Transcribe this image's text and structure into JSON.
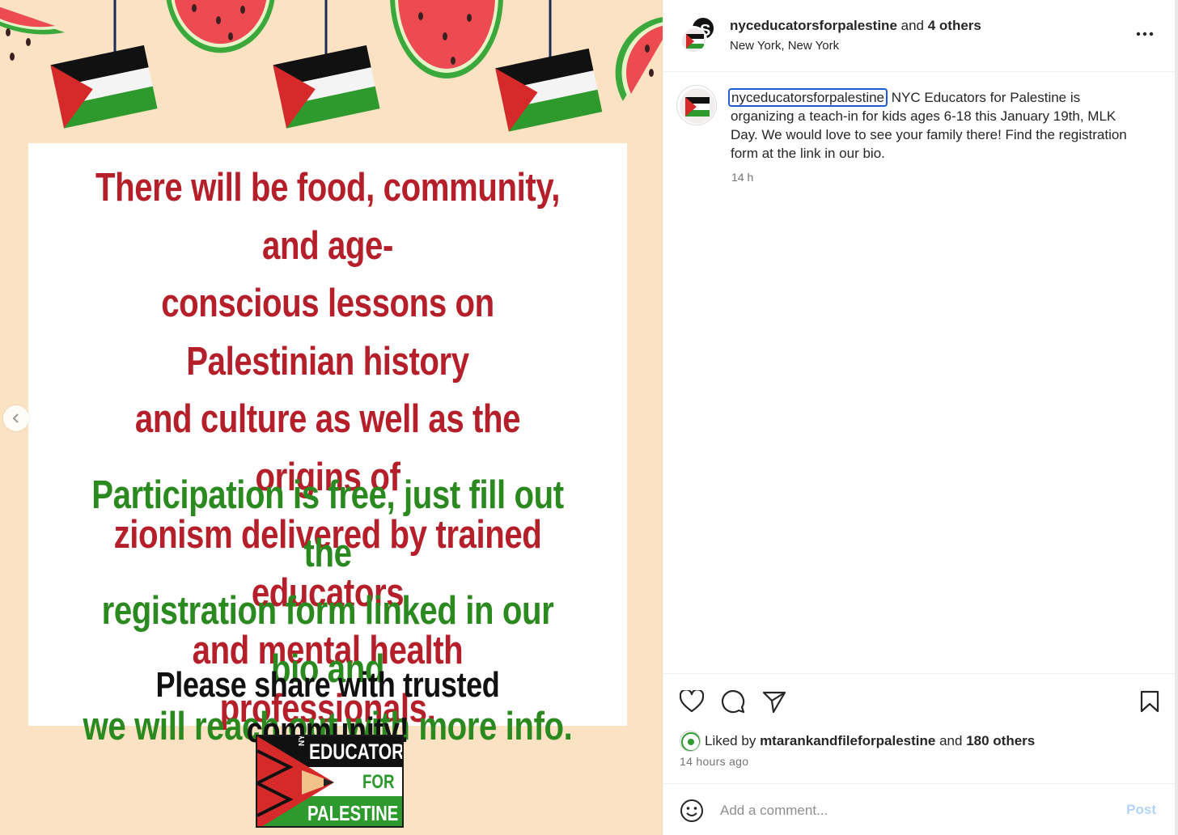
{
  "image": {
    "paragraph_red": "There will be food, community, and age-\nconscious lessons on Palestinian history\nand culture as well as the origins of\nzionism delivered by trained educators\nand mental health professionals.",
    "paragraph_green": "Participation is free, just fill out the\nregistration form linked in our bio and\nwe will reach out with more info.",
    "share_line": "Please share with trusted community!",
    "logo": {
      "nyc": "NYC",
      "educators": "EDUCATORS",
      "for": "FOR",
      "palestine": "PALESTINE"
    },
    "colors": {
      "red": "#b51f2a",
      "green": "#2b8a1f",
      "background": "#fbe2c2"
    }
  },
  "header": {
    "author": "nyceducatorsforpalestine",
    "and_text": "and",
    "others": "4 others",
    "location": "New York, New York",
    "more_icon": "more-horizontal-icon"
  },
  "caption": {
    "username": "nyceducatorsforpalestine",
    "text": "NYC Educators for Palestine is organizing a teach-in for kids ages 6-18 this January 19th, MLK Day. We would love to see your family there! Find the registration form at the link in our bio.",
    "time": "14 h"
  },
  "actions": {
    "like_icon": "heart-icon",
    "comment_icon": "comment-bubble-icon",
    "share_icon": "paper-plane-icon",
    "save_icon": "bookmark-icon"
  },
  "likes": {
    "prefix": "Liked by",
    "user": "mtarankandfileforpalestine",
    "and_text": "and",
    "others": "180 others"
  },
  "post_age": "14 hours ago",
  "comment": {
    "placeholder": "Add a comment...",
    "post_label": "Post",
    "emoji_icon": "smiley-icon"
  }
}
